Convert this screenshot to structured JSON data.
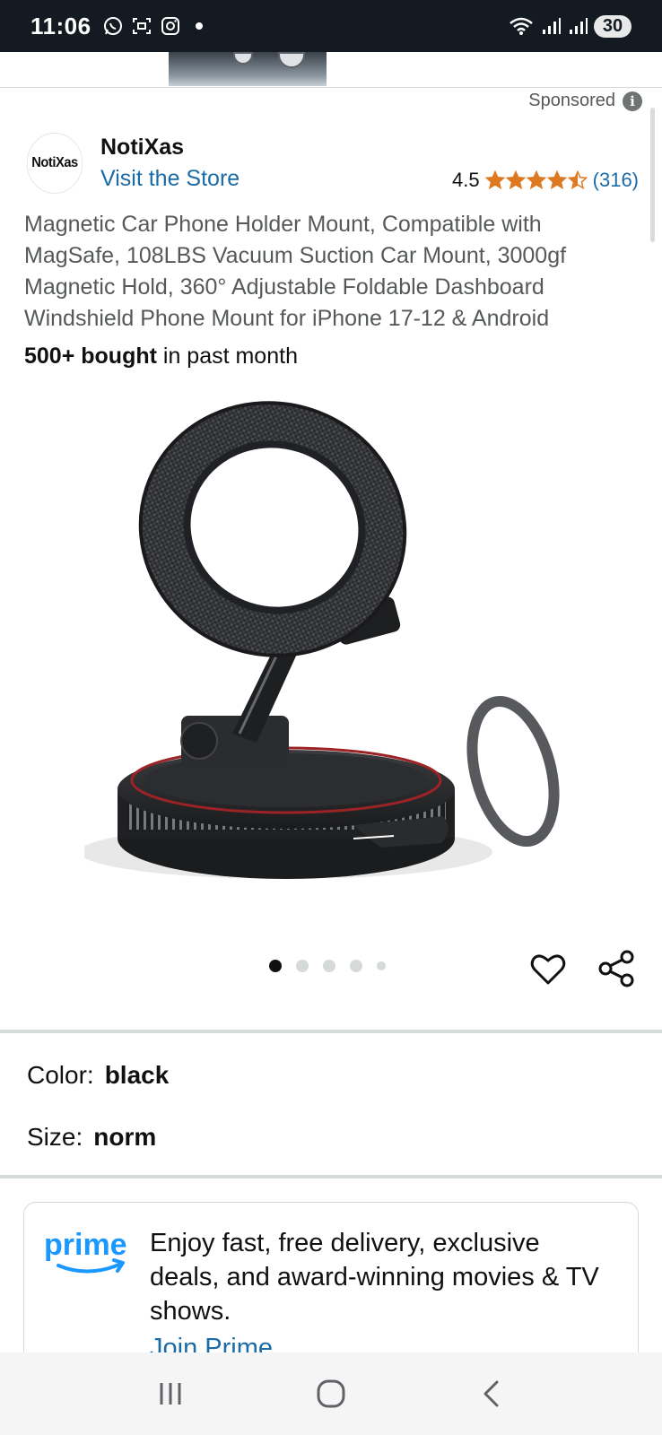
{
  "status_bar": {
    "time": "11:06",
    "battery": "30",
    "icons": [
      "whatsapp-icon",
      "screenshot-icon",
      "instagram-icon",
      "dot-icon",
      "wifi-icon",
      "signal-icon",
      "signal-icon"
    ]
  },
  "ad_strip": {
    "left_text": "",
    "right_text": ""
  },
  "sponsored": {
    "label": "Sponsored",
    "info_icon": "i"
  },
  "brand": {
    "logo_text": "NotiXas",
    "name": "NotiXas",
    "store_link": "Visit the Store"
  },
  "rating": {
    "value": "4.5",
    "stars": 4.5,
    "count": "(316)",
    "star_color": "#de7921"
  },
  "product": {
    "title": "Magnetic Car Phone Holder Mount, Compatible with MagSafe, 108LBS Vacuum Suction Car Mount, 3000gf Magnetic Hold, 360° Adjustable Foldable Dashboard Windshield Phone Mount for iPhone 17-12 & Android",
    "bought_bold": "500+ bought",
    "bought_rest": " in past month"
  },
  "carousel": {
    "total_dots": 5,
    "active_index": 0
  },
  "variants": {
    "color_label": "Color:",
    "color_value": "black",
    "size_label": "Size:",
    "size_value": "norm"
  },
  "prime": {
    "logo_text": "prime",
    "description": "Enjoy fast, free delivery, exclusive deals, and award-winning movies & TV shows.",
    "join_link": "Join Prime",
    "brand_color": "#1a98ff"
  },
  "nav_bar": {
    "buttons": [
      "recents-icon",
      "home-icon",
      "back-icon"
    ]
  },
  "colors": {
    "link": "#1a6ba8",
    "status_bar_bg": "#131a22"
  }
}
